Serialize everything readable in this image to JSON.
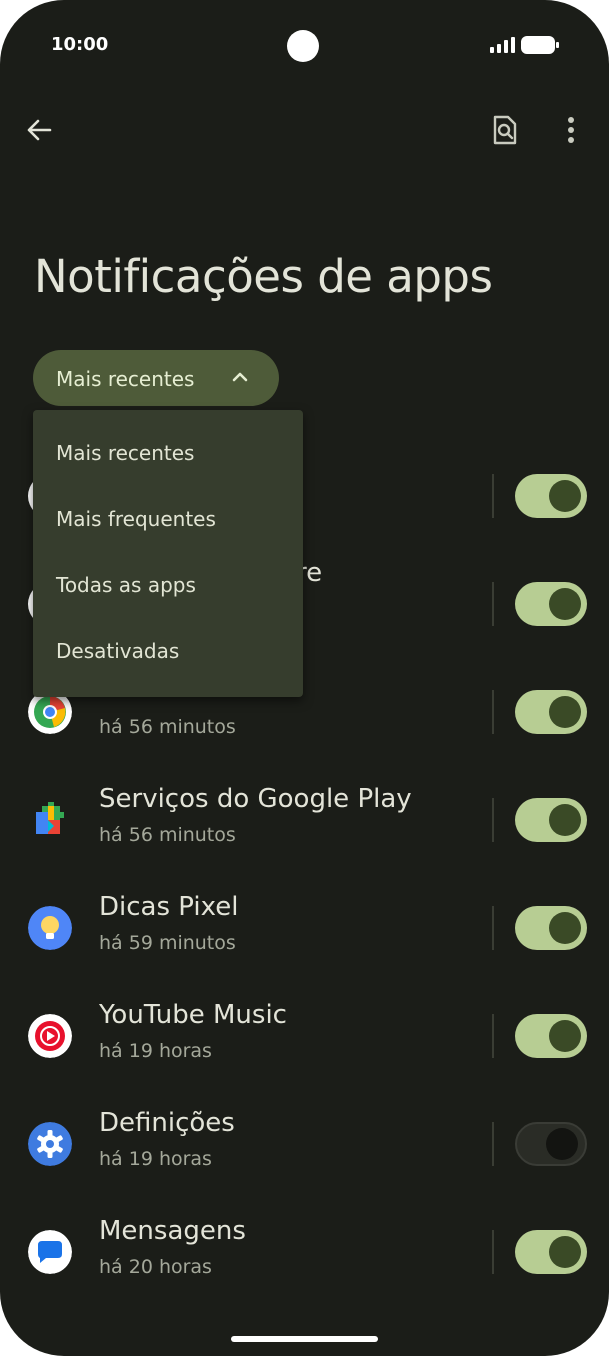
{
  "status_bar": {
    "time": "10:00"
  },
  "header": {
    "title": "Notificações de apps"
  },
  "sort_chip": {
    "label": "Mais recentes"
  },
  "sort_menu": {
    "items": [
      {
        "label": "Mais recentes"
      },
      {
        "label": "Mais frequentes"
      },
      {
        "label": "Todas as apps"
      },
      {
        "label": "Desativadas"
      }
    ]
  },
  "apps": [
    {
      "name": "",
      "time": "",
      "enabled": true
    },
    {
      "name": "re",
      "time": "",
      "enabled": true
    },
    {
      "name": "",
      "time": "há 56 minutos",
      "enabled": true
    },
    {
      "name": "Serviços do Google Play",
      "time": "há 56 minutos",
      "enabled": true
    },
    {
      "name": "Dicas Pixel",
      "time": "há 59 minutos",
      "enabled": true
    },
    {
      "name": "YouTube Music",
      "time": "há 19 horas",
      "enabled": true
    },
    {
      "name": "Definições",
      "time": "há 19 horas",
      "enabled": false
    },
    {
      "name": "Mensagens",
      "time": "há 20 horas",
      "enabled": true
    }
  ],
  "colors": {
    "background": "#1b1d18",
    "chip": "#4e5b39",
    "menu": "#363d2d",
    "switch_on_track": "#b7cd93",
    "switch_on_thumb": "#3a4a26",
    "switch_off_track": "#2a2c26"
  }
}
